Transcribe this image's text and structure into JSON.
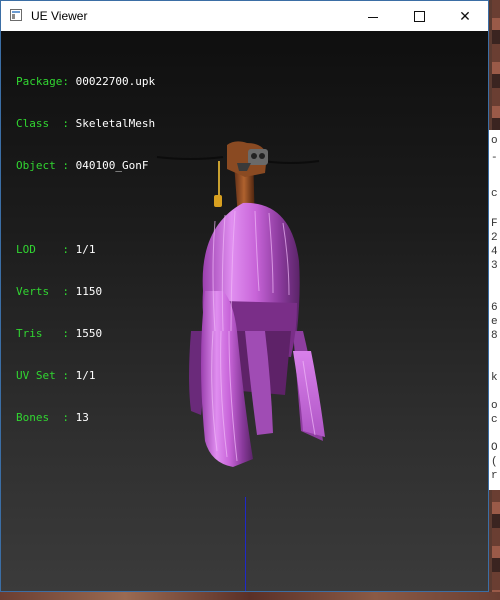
{
  "window": {
    "title": "UE Viewer",
    "controls": {
      "minimize": "minimize",
      "maximize": "maximize",
      "close": "✕"
    }
  },
  "info": {
    "package_label": "Package: ",
    "package": "00022700.upk",
    "class_label": "Class  : ",
    "class": "SkeletalMesh",
    "object_label": "Object : ",
    "object": "040100_GonF",
    "lod_label": "LOD    : ",
    "lod": "1/1",
    "verts_label": "Verts  : ",
    "verts": "1150",
    "tris_label": "Tris   : ",
    "tris": "1550",
    "uvset_label": "UV Set : ",
    "uvset": "1/1",
    "bones_label": "Bones  : ",
    "bones": "13"
  },
  "behind": [
    "o",
    "-",
    "c",
    "F",
    "2",
    "4",
    "3",
    "6",
    "e",
    "8",
    "k",
    "o",
    "c",
    "O",
    "(",
    "r"
  ],
  "colors": {
    "label_green": "#31d631",
    "hair_pink": "#d26ee0",
    "axis_blue": "#1f28c8"
  }
}
